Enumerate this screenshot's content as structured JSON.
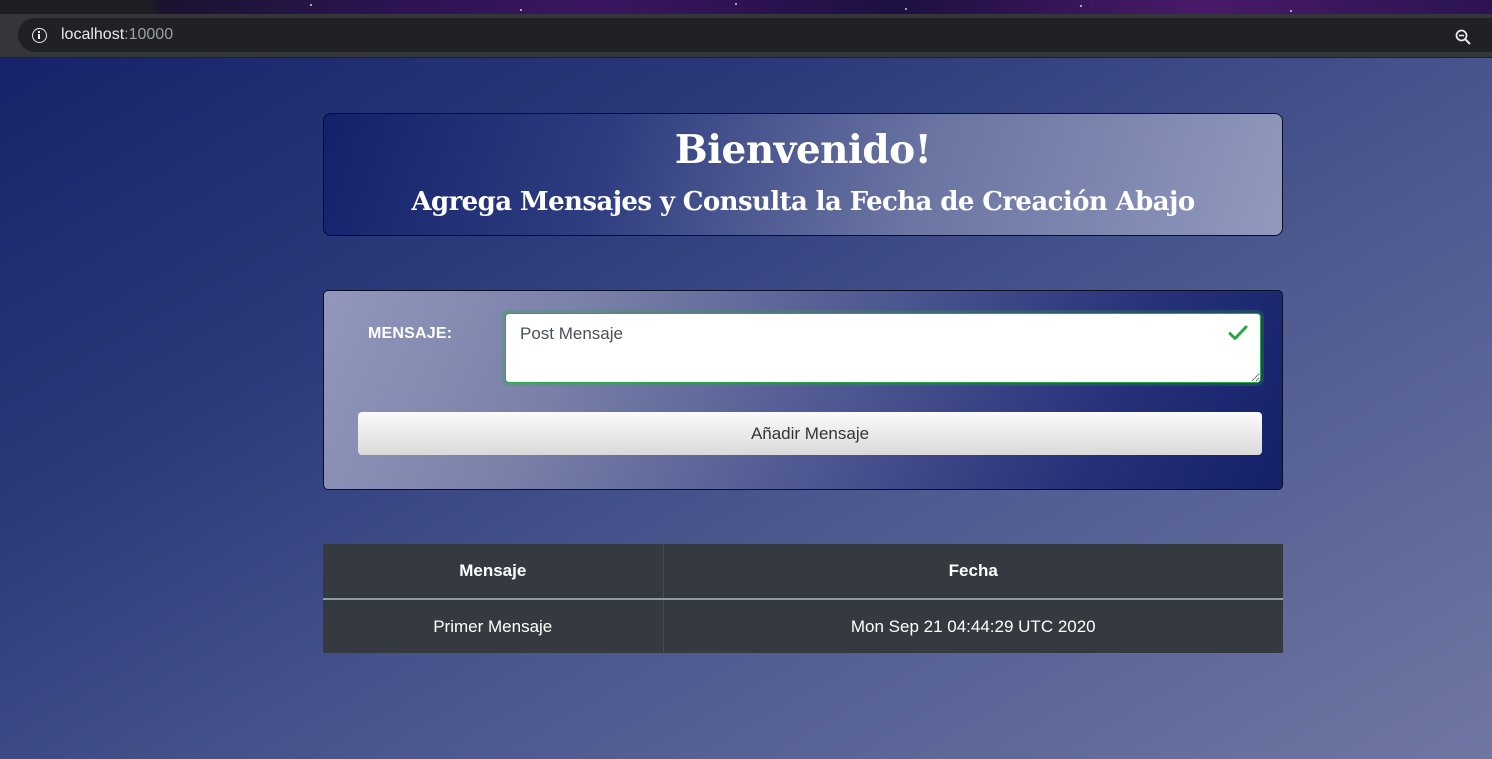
{
  "browser": {
    "host": "localhost",
    "port": ":10000"
  },
  "header": {
    "title": "Bienvenido!",
    "subtitle": "Agrega Mensajes y Consulta la Fecha de Creación Abajo"
  },
  "form": {
    "label": "MENSAJE:",
    "placeholder": "Post Mensaje",
    "value": "",
    "submit_label": "Añadir Mensaje",
    "valid_color": "#28a745"
  },
  "table": {
    "headers": [
      "Mensaje",
      "Fecha"
    ],
    "rows": [
      [
        "Primer Mensaje",
        "Mon Sep 21 04:44:29 UTC 2020"
      ]
    ]
  },
  "icons": {
    "site_info": "info-icon",
    "zoom": "zoom-icon",
    "bookmark": "star-icon",
    "valid": "check-icon"
  }
}
